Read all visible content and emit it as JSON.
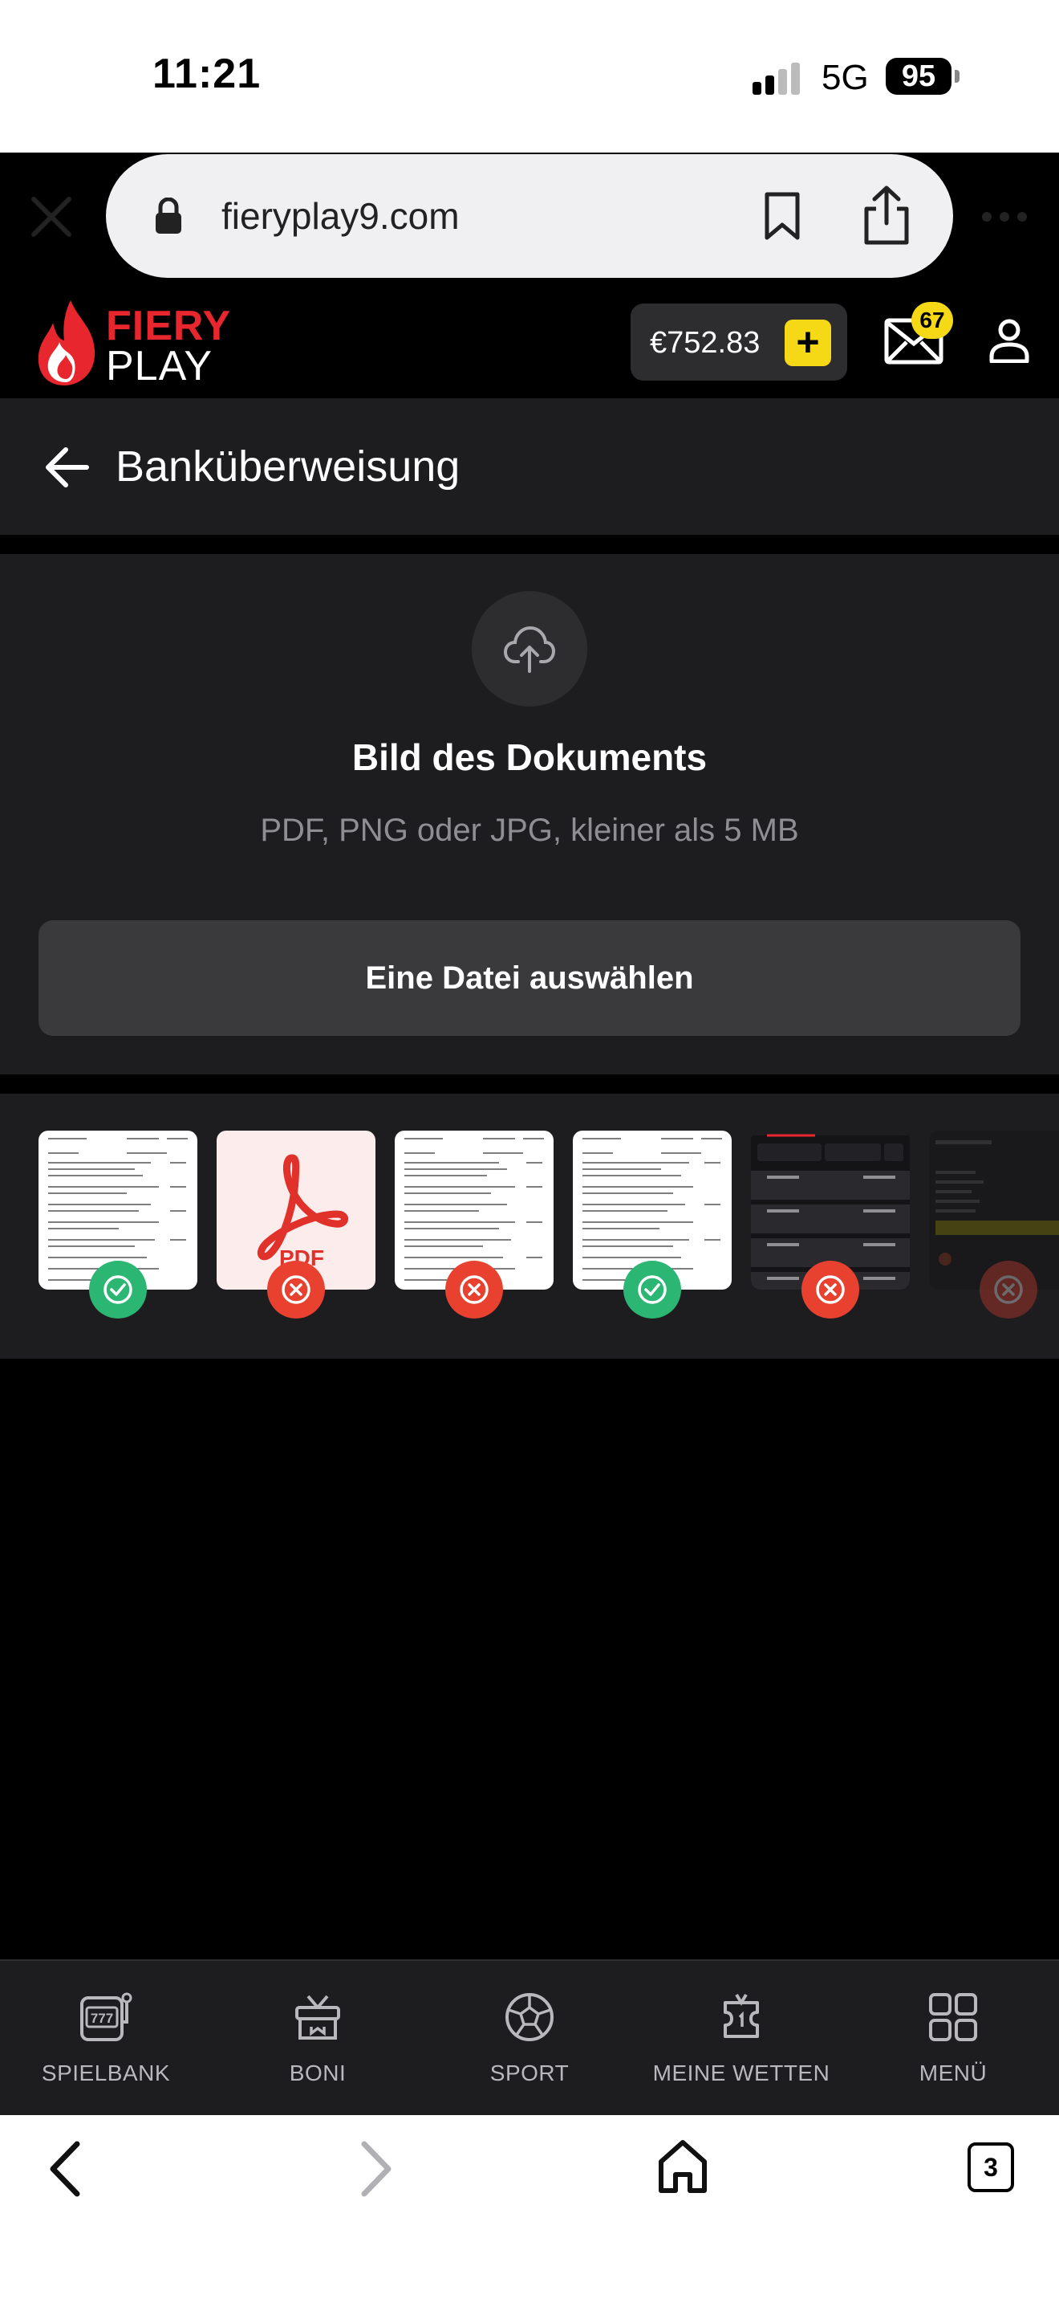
{
  "status": {
    "time": "11:21",
    "network": "5G",
    "battery": "95"
  },
  "browser": {
    "url": "fieryplay9.com"
  },
  "header": {
    "logo_top": "FIERY",
    "logo_bottom": "PLAY",
    "balance": "€752.83",
    "plus": "+",
    "mail_count": "67"
  },
  "page": {
    "title": "Banküberweisung"
  },
  "upload": {
    "title": "Bild des Dokuments",
    "hint": "PDF, PNG oder JPG, kleiner als 5 MB",
    "button": "Eine Datei auswählen"
  },
  "thumbnails": [
    {
      "kind": "document",
      "status": "accepted"
    },
    {
      "kind": "pdf",
      "label": "PDF",
      "status": "rejected"
    },
    {
      "kind": "document",
      "status": "rejected"
    },
    {
      "kind": "document",
      "status": "accepted"
    },
    {
      "kind": "screenshot",
      "status": "rejected"
    },
    {
      "kind": "screenshot",
      "status": "rejected"
    }
  ],
  "nav": {
    "items": [
      {
        "label": "SPIELBANK",
        "icon": "slot-machine-icon"
      },
      {
        "label": "BONI",
        "icon": "gift-icon"
      },
      {
        "label": "SPORT",
        "icon": "soccer-ball-icon"
      },
      {
        "label": "MEINE WETTEN",
        "icon": "ticket-icon"
      },
      {
        "label": "MENÜ",
        "icon": "grid-icon"
      }
    ]
  },
  "toolbar": {
    "tab_count": "3"
  },
  "colors": {
    "brand_red": "#e8262d",
    "accent_yellow": "#f6d916",
    "success": "#2bb673",
    "error": "#e8412f",
    "panel": "#1d1d20"
  }
}
